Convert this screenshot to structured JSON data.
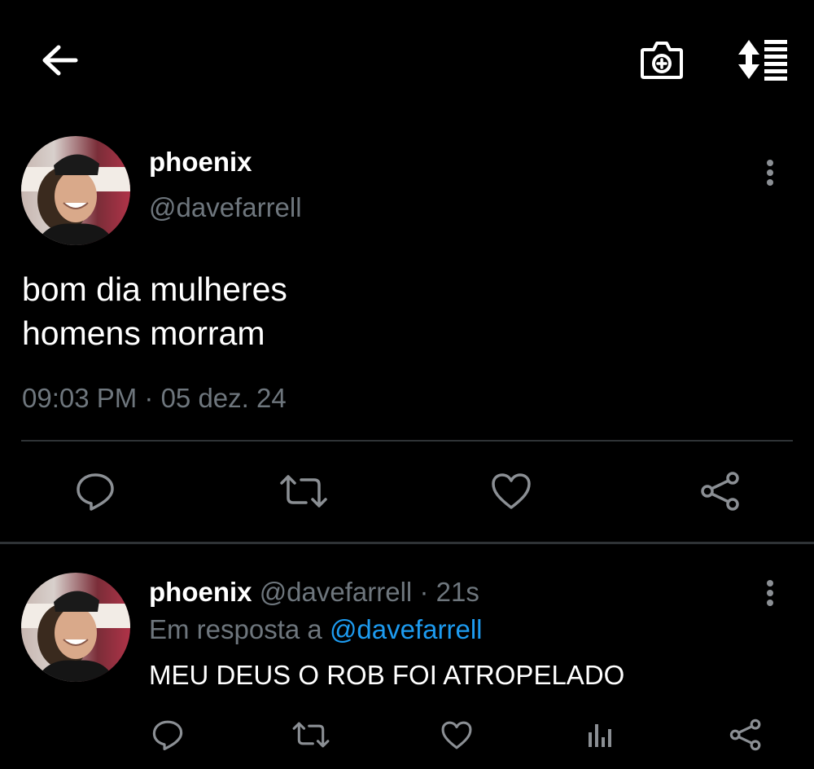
{
  "header": {
    "back_icon": "arrow-left-icon",
    "camera_icon": "camera-plus-icon",
    "sort_icon": "sort-list-icon"
  },
  "tweet": {
    "display_name": "phoenix",
    "handle": "@davefarrell",
    "text": "bom dia mulheres\nhomens morram",
    "timestamp": "09:03 PM · 05 dez. 24",
    "more_icon": "more-vertical-icon",
    "actions": [
      "reply-icon",
      "retweet-icon",
      "like-icon",
      "share-icon"
    ]
  },
  "reply": {
    "display_name": "phoenix",
    "handle": "@davefarrell",
    "separator": "·",
    "age": "21s",
    "replying_to_prefix": "Em resposta a",
    "replying_to_handle": "@davefarrell",
    "text": "MEU DEUS O ROB FOI ATROPELADO",
    "more_icon": "more-vertical-icon",
    "actions": [
      "reply-icon",
      "retweet-icon",
      "like-icon",
      "views-icon",
      "share-icon"
    ]
  },
  "colors": {
    "background": "#000000",
    "text": "#ffffff",
    "muted": "#6e767d",
    "link": "#1d9bf0",
    "divider": "#2f3336"
  }
}
